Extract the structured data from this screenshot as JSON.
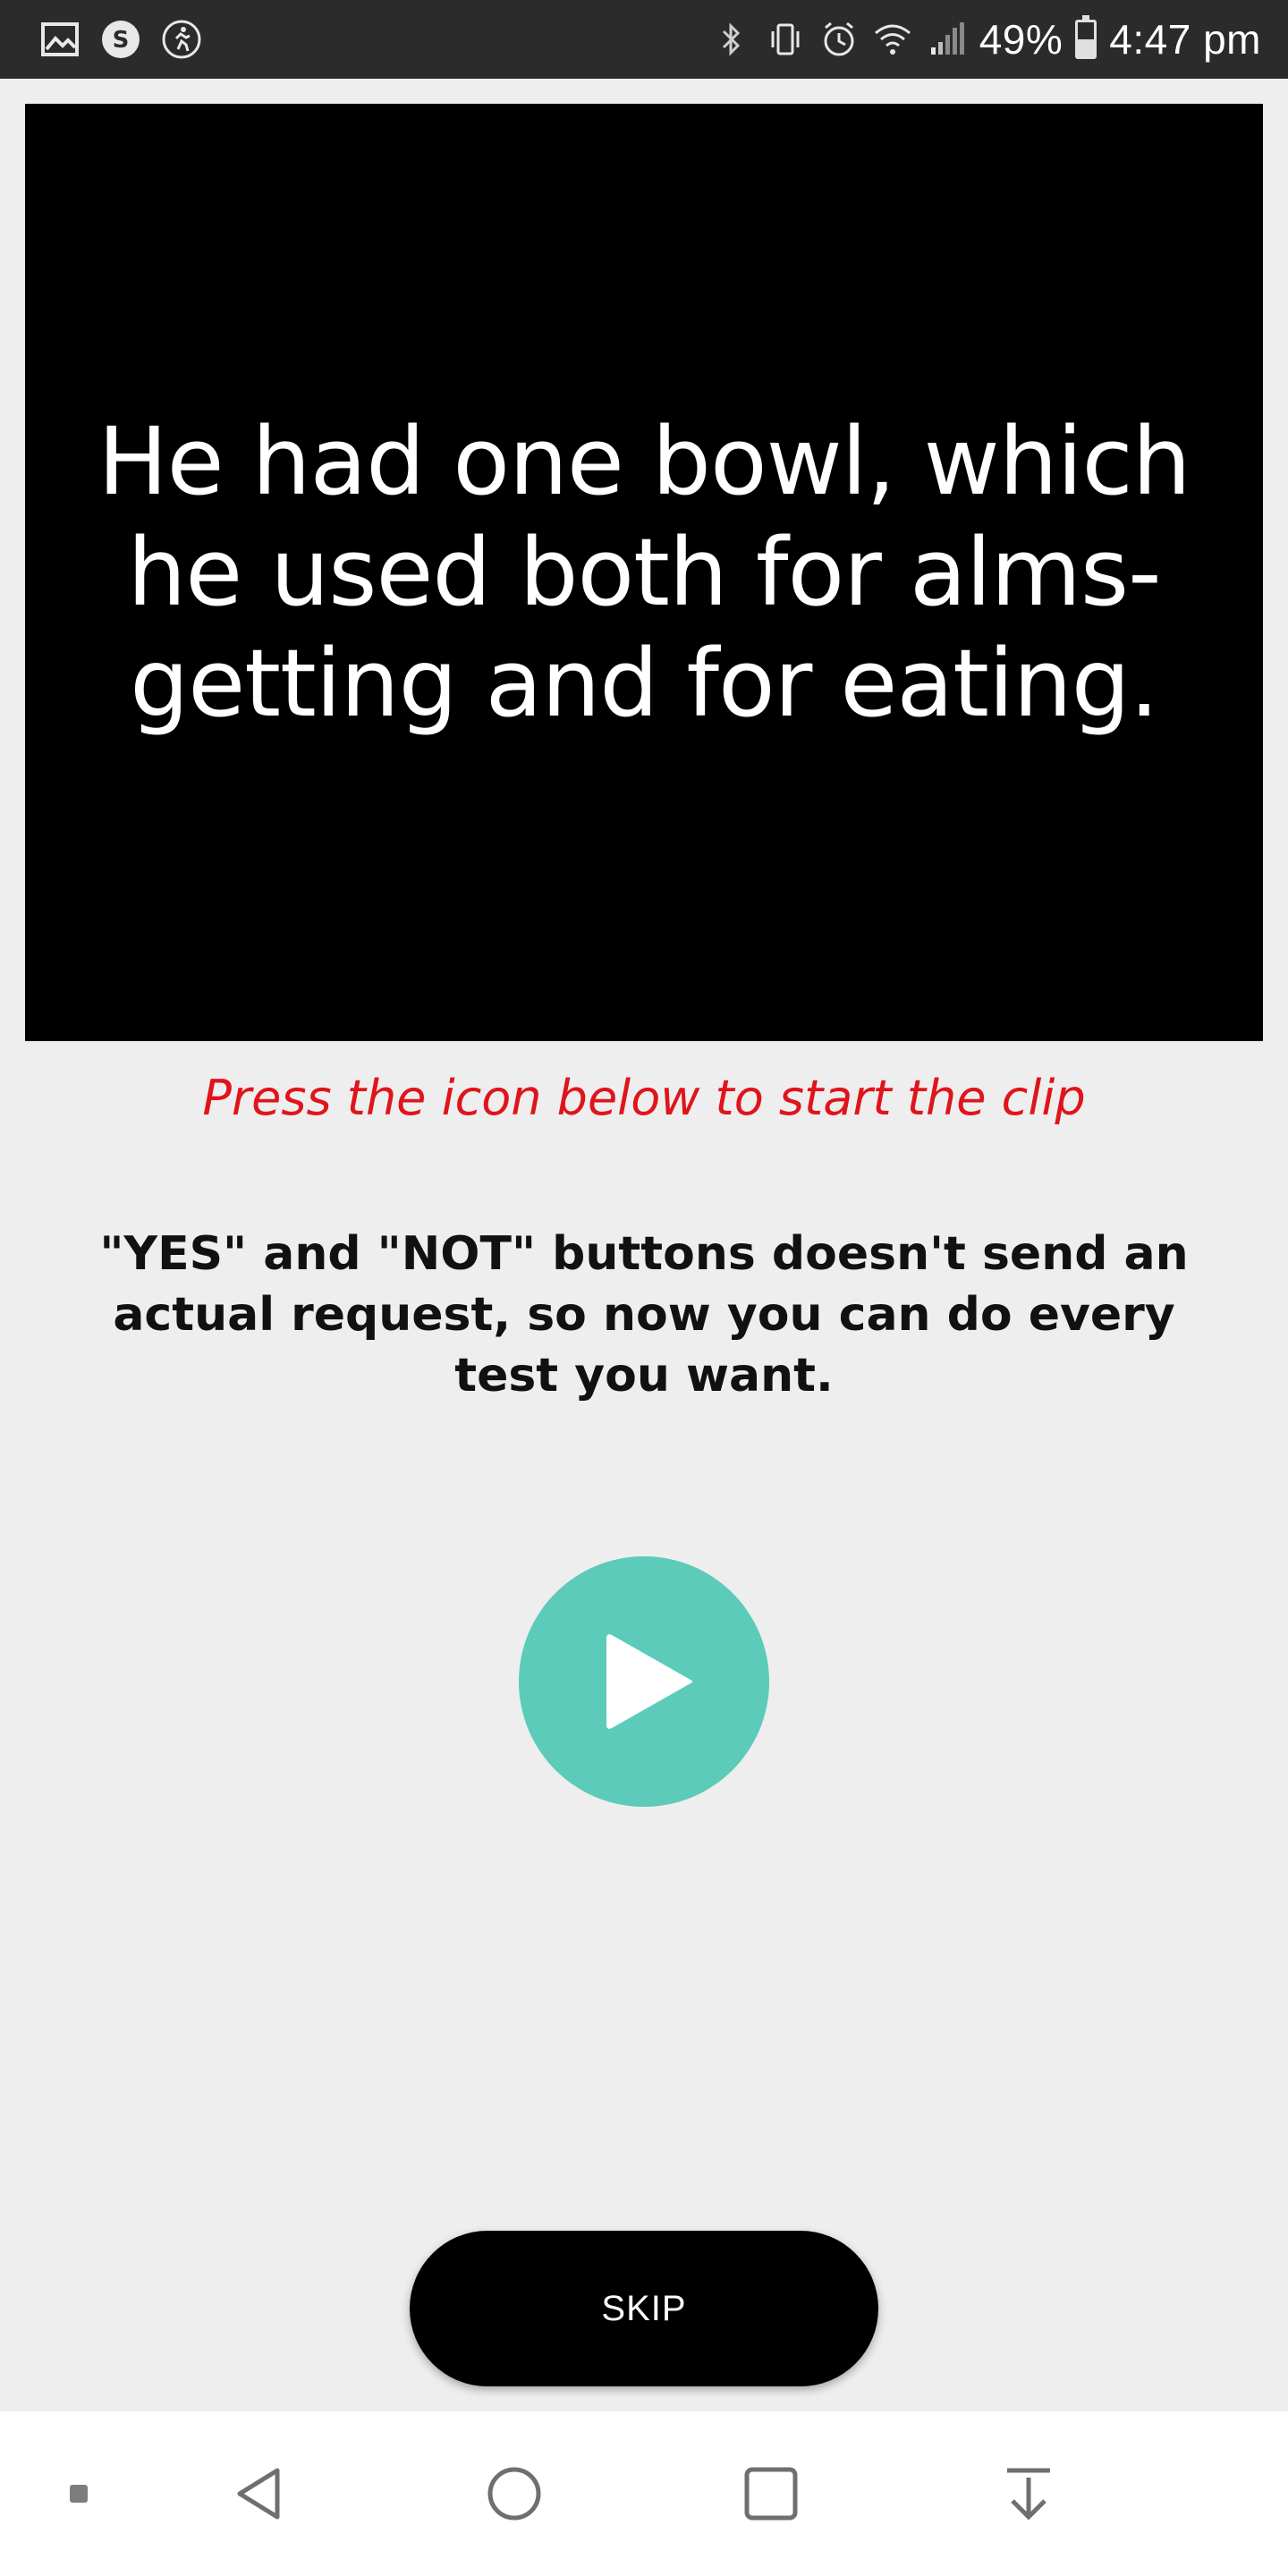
{
  "status_bar": {
    "battery_percent_label": "49%",
    "battery_level": 0.49,
    "time": "4:47 pm",
    "left_icons": [
      "gallery-icon",
      "s-app-icon",
      "walking-icon"
    ],
    "right_icons": [
      "bluetooth-icon",
      "vibrate-icon",
      "alarm-icon",
      "wifi-icon",
      "signal-icon"
    ]
  },
  "video": {
    "subtitle": "He had one bowl, which he used both for alms-getting and for eating."
  },
  "hint": "Press the icon below to start the clip",
  "notice": "\"YES\" and \"NOT\" buttons doesn't send an actual request, so now you can do every test you want.",
  "play_button": {
    "icon": "play-icon"
  },
  "skip_button": {
    "label": "SKIP"
  },
  "nav_bar": {
    "icons": [
      "square-dot-icon",
      "back-icon",
      "home-icon",
      "recents-icon",
      "download-icon"
    ]
  },
  "colors": {
    "accent": "#5ccbb9",
    "hint_red": "#e0141b",
    "background": "#eeeeee",
    "status_bar": "#2b2b2b"
  }
}
